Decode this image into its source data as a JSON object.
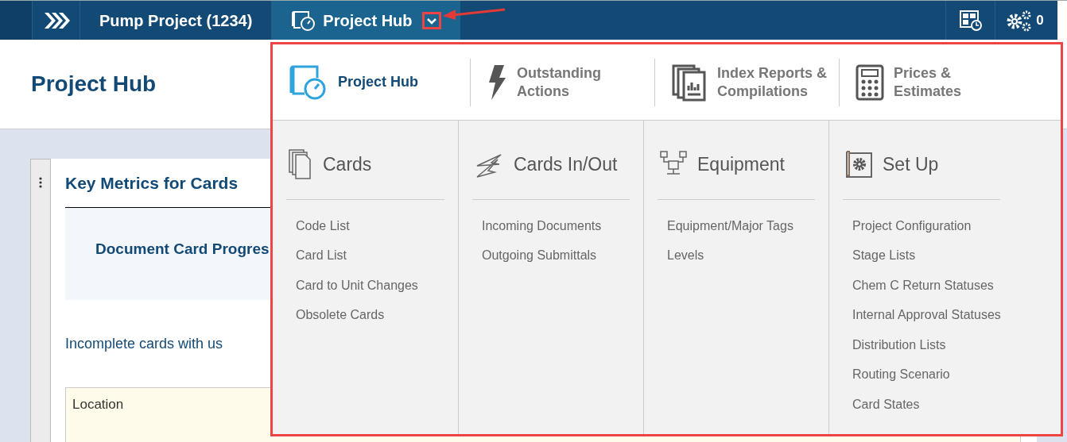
{
  "breadcrumbs": [
    {
      "label": "Pump Project (1234)",
      "selected": false
    },
    {
      "label": "Project Hub",
      "selected": true
    }
  ],
  "toolbar": {
    "notification_count": "0"
  },
  "page": {
    "title": "Project Hub"
  },
  "card": {
    "title": "Key Metrics for Cards",
    "panel_title": "Document Card Progres",
    "subtitle": "Incomplete cards with us",
    "table_columns": [
      "Location"
    ]
  },
  "menu": {
    "top_items": [
      {
        "label": "Project Hub",
        "selected": true
      },
      {
        "label": "Outstanding Actions",
        "selected": false
      },
      {
        "label": "Index Reports & Compilations",
        "selected": false
      },
      {
        "label": "Prices & Estimates",
        "selected": false
      }
    ],
    "sections": [
      {
        "title": "Cards",
        "items": [
          "Code List",
          "Card List",
          "Card to Unit Changes",
          "Obsolete Cards"
        ]
      },
      {
        "title": "Cards In/Out",
        "items": [
          "Incoming Documents",
          "Outgoing Submittals"
        ]
      },
      {
        "title": "Equipment",
        "items": [
          "Equipment/Major Tags",
          "Levels"
        ]
      },
      {
        "title": "Set Up",
        "items": [
          "Project Configuration",
          "Stage Lists",
          "Chem C Return Statuses",
          "Internal Approval Statuses",
          "Distribution Lists",
          "Routing Scenario",
          "Card States"
        ]
      }
    ]
  }
}
